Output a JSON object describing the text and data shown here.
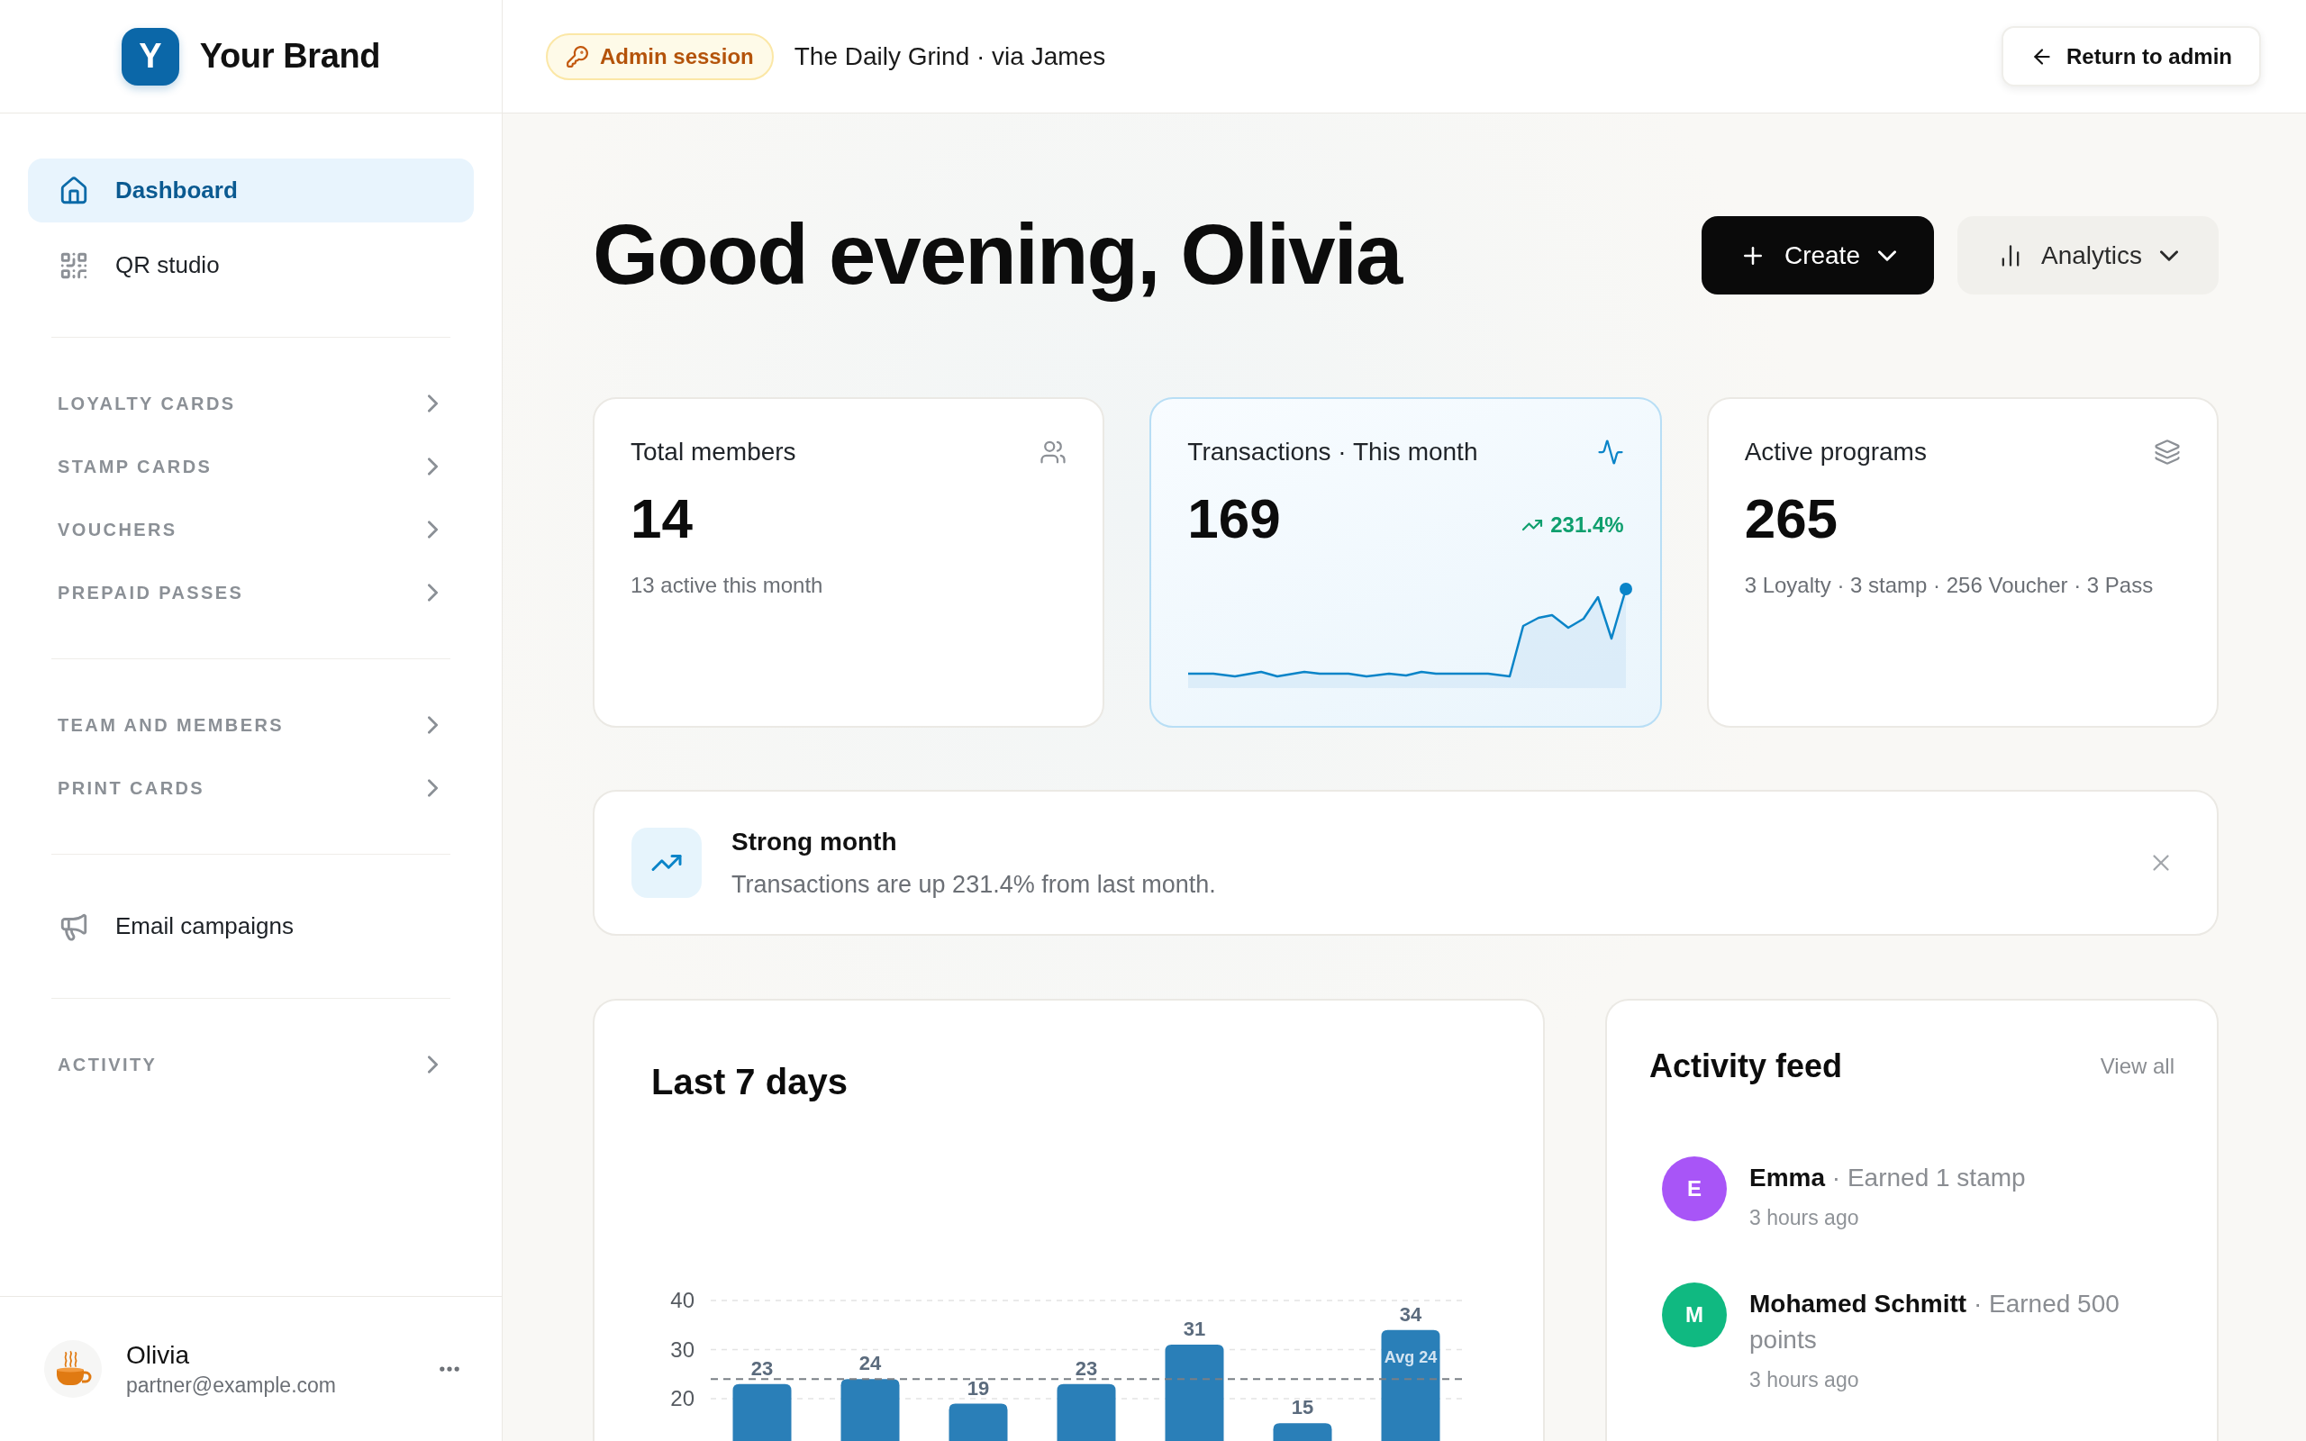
{
  "sidebar": {
    "brand": {
      "logo_letter": "Y",
      "name": "Your Brand"
    },
    "nav_groups": [
      {
        "items": [
          {
            "kind": "link",
            "label": "Dashboard",
            "selected": true
          },
          {
            "kind": "link",
            "label": "QR studio",
            "selected": false
          }
        ]
      },
      {
        "items": [
          {
            "kind": "section",
            "label": "LOYALTY CARDS",
            "expanded": false
          },
          {
            "kind": "section",
            "label": "STAMP CARDS",
            "expanded": false
          },
          {
            "kind": "section",
            "label": "VOUCHERS",
            "expanded": false
          },
          {
            "kind": "section",
            "label": "PREPAID PASSES",
            "expanded": false
          }
        ]
      },
      {
        "items": [
          {
            "kind": "section",
            "label": "TEAM AND MEMBERS",
            "expanded": false
          },
          {
            "kind": "section",
            "label": "PRINT CARDS",
            "expanded": false
          }
        ]
      },
      {
        "items": [
          {
            "kind": "link",
            "label": "Email campaigns",
            "selected": false
          }
        ]
      },
      {
        "items": [
          {
            "kind": "section",
            "label": "ACTIVITY",
            "expanded": false
          }
        ]
      }
    ],
    "user": {
      "name": "Olivia",
      "email": "partner@example.com"
    }
  },
  "top_bar": {
    "badge": "Admin session",
    "context": "The Daily Grind · via James",
    "return_button": "Return to admin"
  },
  "greeting": "Good evening, Olivia",
  "actions": [
    {
      "kind": "primary",
      "label": "Create"
    },
    {
      "kind": "secondary",
      "label": "Analytics"
    }
  ],
  "stats": [
    {
      "kind": "plain",
      "title": "Total members",
      "value": "14",
      "note": "13 active this month"
    },
    {
      "kind": "trend",
      "title": "Transactions · This month",
      "value": "169",
      "trend": "231.4%"
    },
    {
      "kind": "plain",
      "title": "Active programs",
      "value": "265",
      "note": "3 Loyalty · 3 stamp · 256 Voucher · 3 Pass"
    }
  ],
  "banner": {
    "title": "Strong month",
    "message": "Transactions are up 231.4% from last month."
  },
  "weekly_chart": {
    "title": "Last 7 days",
    "chart_data": {
      "type": "bar",
      "values": [
        23,
        24,
        19,
        23,
        31,
        15,
        34
      ],
      "ylim": [
        11.4,
        40
      ],
      "yticks": [
        20,
        30,
        40
      ],
      "data_labels": true,
      "ref_lines": [
        {
          "axis": "y",
          "value": 24,
          "label": "Avg 24"
        }
      ]
    }
  },
  "activity_feed": {
    "title": "Activity feed",
    "link": "View all",
    "items": [
      {
        "initial": "E",
        "color": "#a855f7",
        "text": "**Emma** · Earned 1 stamp",
        "time": "3 hours ago"
      },
      {
        "initial": "M",
        "color": "#10b981",
        "text": "**Mohamed Schmitt** · Earned 500 points",
        "time": "3 hours ago"
      }
    ]
  }
}
